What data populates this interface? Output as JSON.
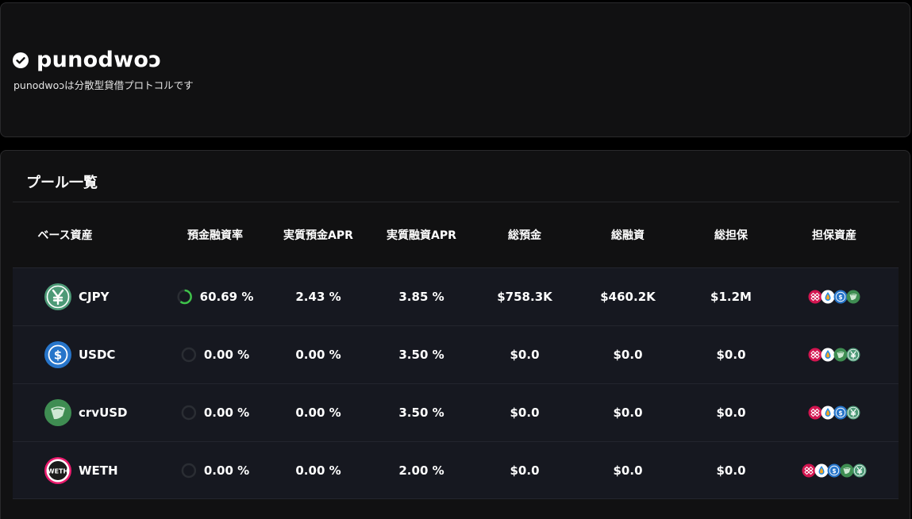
{
  "header": {
    "title": "punodwoɔ",
    "description": "punodwoɔは分散型貸借プロトコルです"
  },
  "pools": {
    "title": "プール一覧",
    "columns": {
      "base": "ベース資産",
      "utilization": "預金融資率",
      "supply_apr": "実質預金APR",
      "borrow_apr": "実質融資APR",
      "total_supply": "総預金",
      "total_borrow": "総融資",
      "total_collateral": "総担保",
      "collateral_assets": "担保資産"
    },
    "rows": [
      {
        "asset": "CJPY",
        "icon": "yen-coin-icon",
        "utilization": "60.69 %",
        "utilization_fraction": 0.6069,
        "supply_apr": "2.43 %",
        "borrow_apr": "3.85 %",
        "total_supply": "$758.3K",
        "total_borrow": "$460.2K",
        "total_collateral": "$1.2M",
        "collateral_icons": [
          "pendle-icon",
          "eth-drop-icon",
          "usdc-icon",
          "crvusd-icon"
        ]
      },
      {
        "asset": "USDC",
        "icon": "usdc-icon",
        "utilization": "0.00 %",
        "utilization_fraction": 0,
        "supply_apr": "0.00 %",
        "borrow_apr": "3.50 %",
        "total_supply": "$0.0",
        "total_borrow": "$0.0",
        "total_collateral": "$0.0",
        "collateral_icons": [
          "pendle-icon",
          "eth-drop-icon",
          "crvusd-icon",
          "yen-coin-icon"
        ]
      },
      {
        "asset": "crvUSD",
        "icon": "crvusd-icon",
        "utilization": "0.00 %",
        "utilization_fraction": 0,
        "supply_apr": "0.00 %",
        "borrow_apr": "3.50 %",
        "total_supply": "$0.0",
        "total_borrow": "$0.0",
        "total_collateral": "$0.0",
        "collateral_icons": [
          "pendle-icon",
          "eth-drop-icon",
          "usdc-icon",
          "yen-coin-icon"
        ]
      },
      {
        "asset": "WETH",
        "icon": "weth-icon",
        "utilization": "0.00 %",
        "utilization_fraction": 0,
        "supply_apr": "0.00 %",
        "borrow_apr": "2.00 %",
        "total_supply": "$0.0",
        "total_borrow": "$0.0",
        "total_collateral": "$0.0",
        "collateral_icons": [
          "pendle-icon",
          "eth-drop-icon",
          "usdc-icon",
          "crvusd-icon",
          "yen-coin-icon"
        ]
      }
    ]
  },
  "colors": {
    "background": "#000000",
    "card": "#111112",
    "row": "#161820",
    "ring_track": "#2a2d33",
    "ring_progress": "#3ec24a"
  }
}
